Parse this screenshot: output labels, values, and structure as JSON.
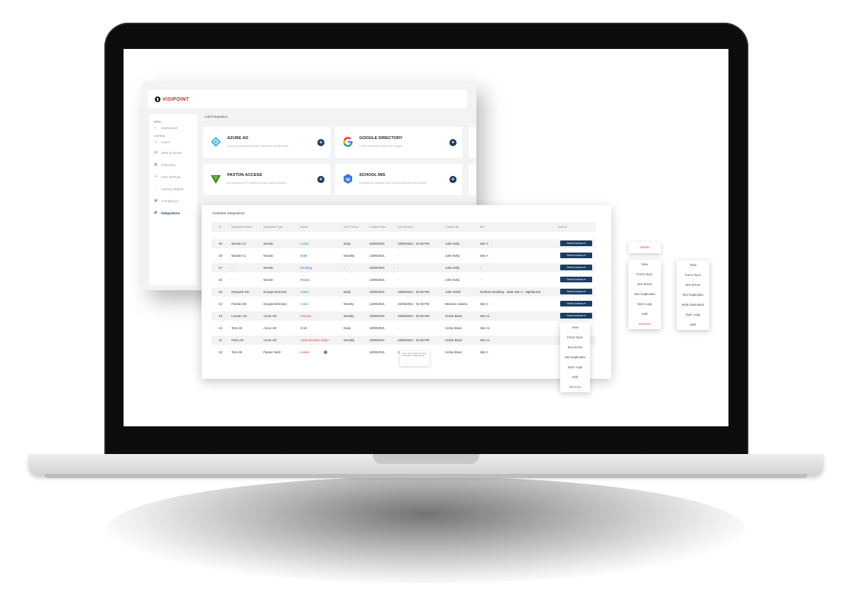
{
  "app": {
    "logo_text": "VISIPOINT",
    "brand_color": "#c62828",
    "accent_color": "#1c3d63"
  },
  "sidebar": {
    "menu_heading": "MENU",
    "system_heading": "SYSTEM",
    "items": [
      {
        "label": "Dashboard",
        "icon": "home-icon"
      },
      {
        "label": "Users",
        "icon": "users-icon"
      },
      {
        "label": "Sites & Kiosks",
        "icon": "building-icon"
      },
      {
        "label": "Reporting",
        "icon": "report-icon"
      },
      {
        "label": "User Settings",
        "icon": "user-settings-icon"
      },
      {
        "label": "Journey Builder",
        "icon": "journey-icon"
      },
      {
        "label": "Compliance",
        "icon": "compliance-icon"
      },
      {
        "label": "Integrations",
        "icon": "integrations-icon",
        "active": true
      }
    ]
  },
  "add_integration": {
    "title": "Add Integration",
    "cards": [
      {
        "name": "AZURE AD",
        "desc": "A cloud computing service operated by Microsoft",
        "icon": "azure-logo-icon"
      },
      {
        "name": "GOOGLE DIRECTORY",
        "desc": "A web directory hosted by Google",
        "icon": "google-logo-icon"
      },
      {
        "name": "PAXTON ACCESS",
        "desc": "An advanced PC based access control solution",
        "icon": "paxton-logo-icon"
      },
      {
        "name": "SCHOOL MIS",
        "desc": "Integrate to Visipoint with your school MIS via Wonde",
        "icon": "wonde-logo-icon"
      }
    ]
  },
  "table": {
    "title": "Available Integrations",
    "headers": [
      "ID",
      "Integration Name",
      "Integration Type",
      "Status",
      "Sync Period",
      "Creation Date",
      "Last Synced",
      "Created By",
      "Site",
      "Actions"
    ],
    "action_label": "Select Actions ▾",
    "rows": [
      [
        "49",
        "Wonde A2",
        "Wonde",
        "Active",
        "Daily",
        "15/09/2021",
        "19/09/2021 - 02:30 PM",
        "John Kelly",
        "Site C"
      ],
      [
        "48",
        "Wonde A1",
        "Wonde",
        "Draft",
        "Monthly",
        "14/09/2021",
        "-",
        "John Kelly",
        "Site A"
      ],
      [
        "47",
        "-",
        "Wonde",
        "Pending",
        "-",
        "15/09/2021",
        "-",
        "John Kelly",
        "-"
      ],
      [
        "46",
        "-",
        "Wonde",
        "Ready",
        "-",
        "14/09/2021",
        "-",
        "John Kelly",
        "-"
      ],
      [
        "45",
        "Newyork GD",
        "Google Directory",
        "Active",
        "Daily",
        "15/09/2021",
        "15/09/2021 - 02:30 PM",
        "John Smith",
        "Northern Building - Main Site A - Highland B"
      ],
      [
        "44",
        "Florida GD",
        "Google Directory",
        "Active",
        "Weekly",
        "14/09/2021",
        "15/09/2021 - 02:30 PM",
        "Brandon Adams",
        "Site C"
      ],
      [
        "43",
        "London AD",
        "Azure AD",
        "Inactive",
        "Weekly",
        "15/09/2021",
        "15/09/2021 - 02:30 PM",
        "Celine Blunt",
        "Site A1"
      ],
      [
        "42",
        "Test AD",
        "Azure AD",
        "Draft",
        "Daily",
        "15/09/2021",
        "-",
        "Celine Blunt",
        "Site A1"
      ],
      [
        "41",
        "Paris AD",
        "Azure AD",
        "Authentication failed",
        "Monthly",
        "15/09/2021",
        "15/09/2021 - 02:30 PM",
        "Celine Blunt",
        "Site A1"
      ],
      [
        "40",
        "Test AD",
        "Paxton Net2",
        "Invalid",
        "",
        "15/09/2021",
        "15/09/2021 - 02:30 PM",
        "Celine Blunt",
        "Site C"
      ]
    ],
    "status_colors": {
      "Active": "#2e9e57",
      "Draft": "#2d6cd2",
      "Pending": "#2d6cd2",
      "Ready": "#2d6cd2",
      "Inactive": "#e0453a",
      "Authentication failed": "#e0453a",
      "Invalid": "#e0453a"
    },
    "tooltip_text": "Lorem ipsum dolor sit amet, consectetur adipiscing elit"
  },
  "menus": {
    "row_menu": [
      "View",
      "Force Sync",
      "See Errors",
      "See Duplicates",
      "Sync Logs",
      "Edit",
      "Remove"
    ],
    "single": "Delete",
    "menu_a": [
      "View",
      "Force Sync",
      "See Errors",
      "See Duplicates",
      "Sync Logs",
      "Edit",
      "Remove"
    ],
    "menu_b": [
      "View",
      "Force Sync",
      "See Errors",
      "See Duplicates",
      "Write Data Back",
      "Sync Logs",
      "Edit"
    ]
  }
}
